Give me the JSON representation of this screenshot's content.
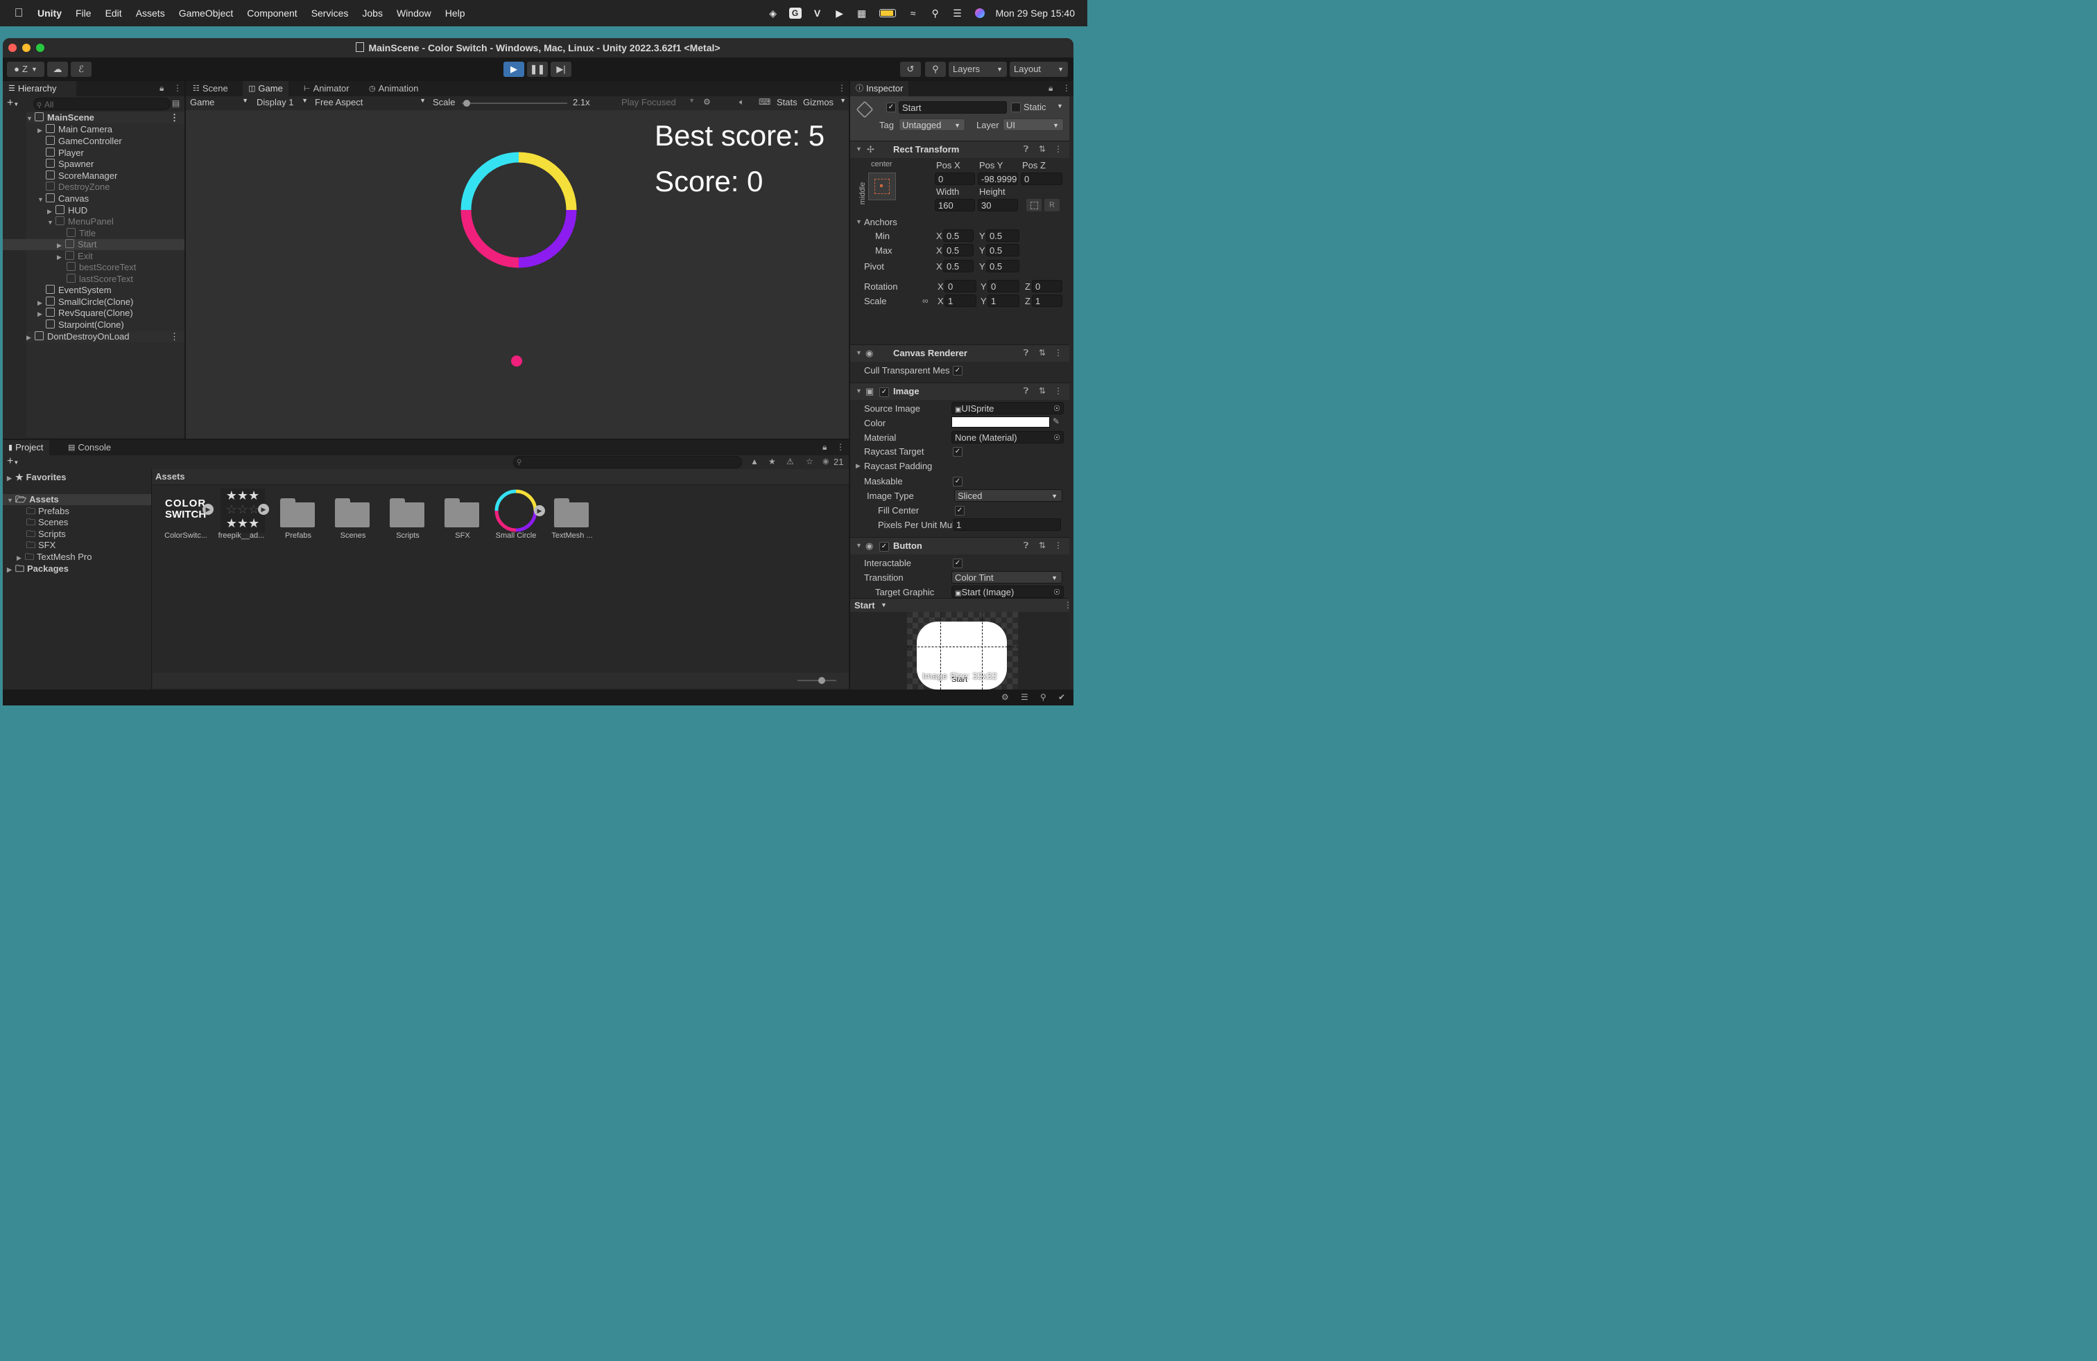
{
  "menubar": {
    "app_name": "Unity",
    "items": [
      "File",
      "Edit",
      "Assets",
      "GameObject",
      "Component",
      "Services",
      "Jobs",
      "Window",
      "Help"
    ],
    "clock": "Mon 29 Sep  15:40"
  },
  "window": {
    "title": "MainScene - Color Switch - Windows, Mac, Linux - Unity 2022.3.62f1 <Metal>"
  },
  "toolbar": {
    "account": "Z",
    "layers": "Layers",
    "layout": "Layout"
  },
  "hierarchy": {
    "tab": "Hierarchy",
    "search_placeholder": "All",
    "items": [
      {
        "label": "MainScene",
        "bold": true
      },
      {
        "label": "Main Camera"
      },
      {
        "label": "GameController"
      },
      {
        "label": "Player"
      },
      {
        "label": "Spawner"
      },
      {
        "label": "ScoreManager"
      },
      {
        "label": "DestroyZone",
        "dim": true
      },
      {
        "label": "Canvas"
      },
      {
        "label": "HUD"
      },
      {
        "label": "MenuPanel",
        "dim": true
      },
      {
        "label": "Title",
        "dim": true
      },
      {
        "label": "Start",
        "dim": true,
        "selected": true
      },
      {
        "label": "Exit",
        "dim": true
      },
      {
        "label": "bestScoreText",
        "dim": true
      },
      {
        "label": "lastScoreText",
        "dim": true
      },
      {
        "label": "EventSystem"
      },
      {
        "label": "SmallCircle(Clone)"
      },
      {
        "label": "RevSquare(Clone)"
      },
      {
        "label": "Starpoint(Clone)"
      },
      {
        "label": "DontDestroyOnLoad"
      }
    ]
  },
  "view_tabs": {
    "scene": "Scene",
    "game": "Game",
    "animator": "Animator",
    "animation": "Animation"
  },
  "game_toolbar": {
    "mode": "Game",
    "display": "Display 1",
    "aspect": "Free Aspect",
    "scale_label": "Scale",
    "scale_value": "2.1x",
    "play_focused": "Play Focused",
    "stats": "Stats",
    "gizmos": "Gizmos"
  },
  "game": {
    "best_score": "Best score: 5",
    "score": "Score: 0",
    "ring_colors": [
      "#f5df3a",
      "#8c1cf0",
      "#f0207c",
      "#35e2f2"
    ],
    "ball_color": "#f0207c"
  },
  "project": {
    "tab_project": "Project",
    "tab_console": "Console",
    "count": "21",
    "favorites": "Favorites",
    "tree": [
      {
        "label": "Assets",
        "bold": true
      },
      {
        "label": "Prefabs"
      },
      {
        "label": "Scenes"
      },
      {
        "label": "Scripts"
      },
      {
        "label": "SFX"
      },
      {
        "label": "TextMesh Pro"
      },
      {
        "label": "Packages",
        "bold": true
      }
    ],
    "breadcrumb": "Assets",
    "assets": [
      {
        "label": "ColorSwitc...",
        "kind": "audio",
        "logo_top": "COLOR",
        "logo_bottom": "SWITCH"
      },
      {
        "label": "freepik__ad...",
        "kind": "audio-stars"
      },
      {
        "label": "Prefabs",
        "kind": "folder"
      },
      {
        "label": "Scenes",
        "kind": "folder"
      },
      {
        "label": "Scripts",
        "kind": "folder"
      },
      {
        "label": "SFX",
        "kind": "folder"
      },
      {
        "label": "Small Circle",
        "kind": "ring"
      },
      {
        "label": "TextMesh ...",
        "kind": "folder"
      }
    ]
  },
  "inspector": {
    "tab": "Inspector",
    "object_name": "Start",
    "static": "Static",
    "tag_label": "Tag",
    "tag_value": "Untagged",
    "layer_label": "Layer",
    "layer_value": "UI",
    "rect_transform": {
      "title": "Rect Transform",
      "anchor_h": "center",
      "anchor_v": "middle",
      "pos_x_label": "Pos X",
      "pos_y_label": "Pos Y",
      "pos_z_label": "Pos Z",
      "pos_x": "0",
      "pos_y": "-98.9999",
      "pos_z": "0",
      "width_label": "Width",
      "height_label": "Height",
      "width": "160",
      "height": "30",
      "r_button": "R",
      "anchors": "Anchors",
      "min": "Min",
      "max": "Max",
      "pivot": "Pivot",
      "min_x": "0.5",
      "min_y": "0.5",
      "max_x": "0.5",
      "max_y": "0.5",
      "pivot_x": "0.5",
      "pivot_y": "0.5",
      "rotation": "Rotation",
      "scale": "Scale",
      "rot_x": "0",
      "rot_y": "0",
      "rot_z": "0",
      "scale_x": "1",
      "scale_y": "1",
      "scale_z": "1"
    },
    "canvas_renderer": {
      "title": "Canvas Renderer",
      "cull": "Cull Transparent Mes"
    },
    "image": {
      "title": "Image",
      "source_image_label": "Source Image",
      "source_image": "UISprite",
      "color_label": "Color",
      "color": "#ffffff",
      "material_label": "Material",
      "material": "None (Material)",
      "raycast_target": "Raycast Target",
      "raycast_padding": "Raycast Padding",
      "maskable": "Maskable",
      "image_type_label": "Image Type",
      "image_type": "Sliced",
      "fill_center": "Fill Center",
      "ppu_label": "Pixels Per Unit Mul",
      "ppu": "1"
    },
    "button": {
      "title": "Button",
      "interactable": "Interactable",
      "transition_label": "Transition",
      "transition": "Color Tint",
      "target_graphic_label": "Target Graphic",
      "target_graphic": "Start (Image)"
    },
    "preview": {
      "header": "Start",
      "name": "Start",
      "size": "Image Size: 32x32"
    },
    "axis": {
      "x": "X",
      "y": "Y",
      "z": "Z"
    }
  }
}
